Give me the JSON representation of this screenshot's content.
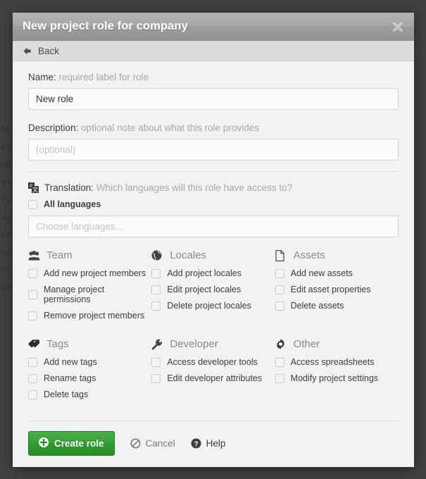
{
  "backdrop": {
    "fragments": [
      "lic",
      "v )",
      "eas",
      "e t",
      "try",
      "ag",
      "ich",
      "ion",
      "rn",
      "bo"
    ]
  },
  "modal": {
    "title": "New project role for company",
    "close_icon": "close-icon",
    "back": {
      "label": "Back",
      "icon": "arrow-left-icon"
    },
    "name": {
      "label": "Name:",
      "hint": "required label for role",
      "value": "New role",
      "placeholder": ""
    },
    "description": {
      "label": "Description:",
      "hint": "optional note about what this role provides",
      "value": "",
      "placeholder": "(optional)"
    },
    "translation": {
      "icon": "translation-icon",
      "label": "Translation:",
      "hint": "Which languages will this role have access to?",
      "all_languages_label": "All languages",
      "all_languages_checked": false,
      "languages_placeholder": "Choose languages...",
      "languages_value": ""
    },
    "permission_groups": [
      {
        "title": "Team",
        "icon": "users-icon",
        "items": [
          {
            "label": "Add new project members",
            "checked": false
          },
          {
            "label": "Manage project permissions",
            "checked": false
          },
          {
            "label": "Remove project members",
            "checked": false
          }
        ]
      },
      {
        "title": "Locales",
        "icon": "globe-icon",
        "items": [
          {
            "label": "Add project locales",
            "checked": false
          },
          {
            "label": "Edit project locales",
            "checked": false
          },
          {
            "label": "Delete project locales",
            "checked": false
          }
        ]
      },
      {
        "title": "Assets",
        "icon": "file-icon",
        "items": [
          {
            "label": "Add new assets",
            "checked": false
          },
          {
            "label": "Edit asset properties",
            "checked": false
          },
          {
            "label": "Delete assets",
            "checked": false
          }
        ]
      },
      {
        "title": "Tags",
        "icon": "tag-icon",
        "items": [
          {
            "label": "Add new tags",
            "checked": false
          },
          {
            "label": "Rename tags",
            "checked": false
          },
          {
            "label": "Delete tags",
            "checked": false
          }
        ]
      },
      {
        "title": "Developer",
        "icon": "wrench-icon",
        "items": [
          {
            "label": "Access developer tools",
            "checked": false
          },
          {
            "label": "Edit developer attributes",
            "checked": false
          }
        ]
      },
      {
        "title": "Other",
        "icon": "gear-icon",
        "items": [
          {
            "label": "Access spreadsheets",
            "checked": false
          },
          {
            "label": "Modify project settings",
            "checked": false
          }
        ]
      }
    ],
    "footer": {
      "create_label": "Create role",
      "create_icon": "plus-circle-icon",
      "cancel_label": "Cancel",
      "cancel_icon": "ban-icon",
      "help_label": "Help",
      "help_icon": "question-circle-icon"
    }
  },
  "colors": {
    "primary_green": "#2f9a2f",
    "titlebar_gray": "#a6a6a6",
    "body_bg": "#f2f2f2",
    "muted_text": "#a8a8a8"
  }
}
